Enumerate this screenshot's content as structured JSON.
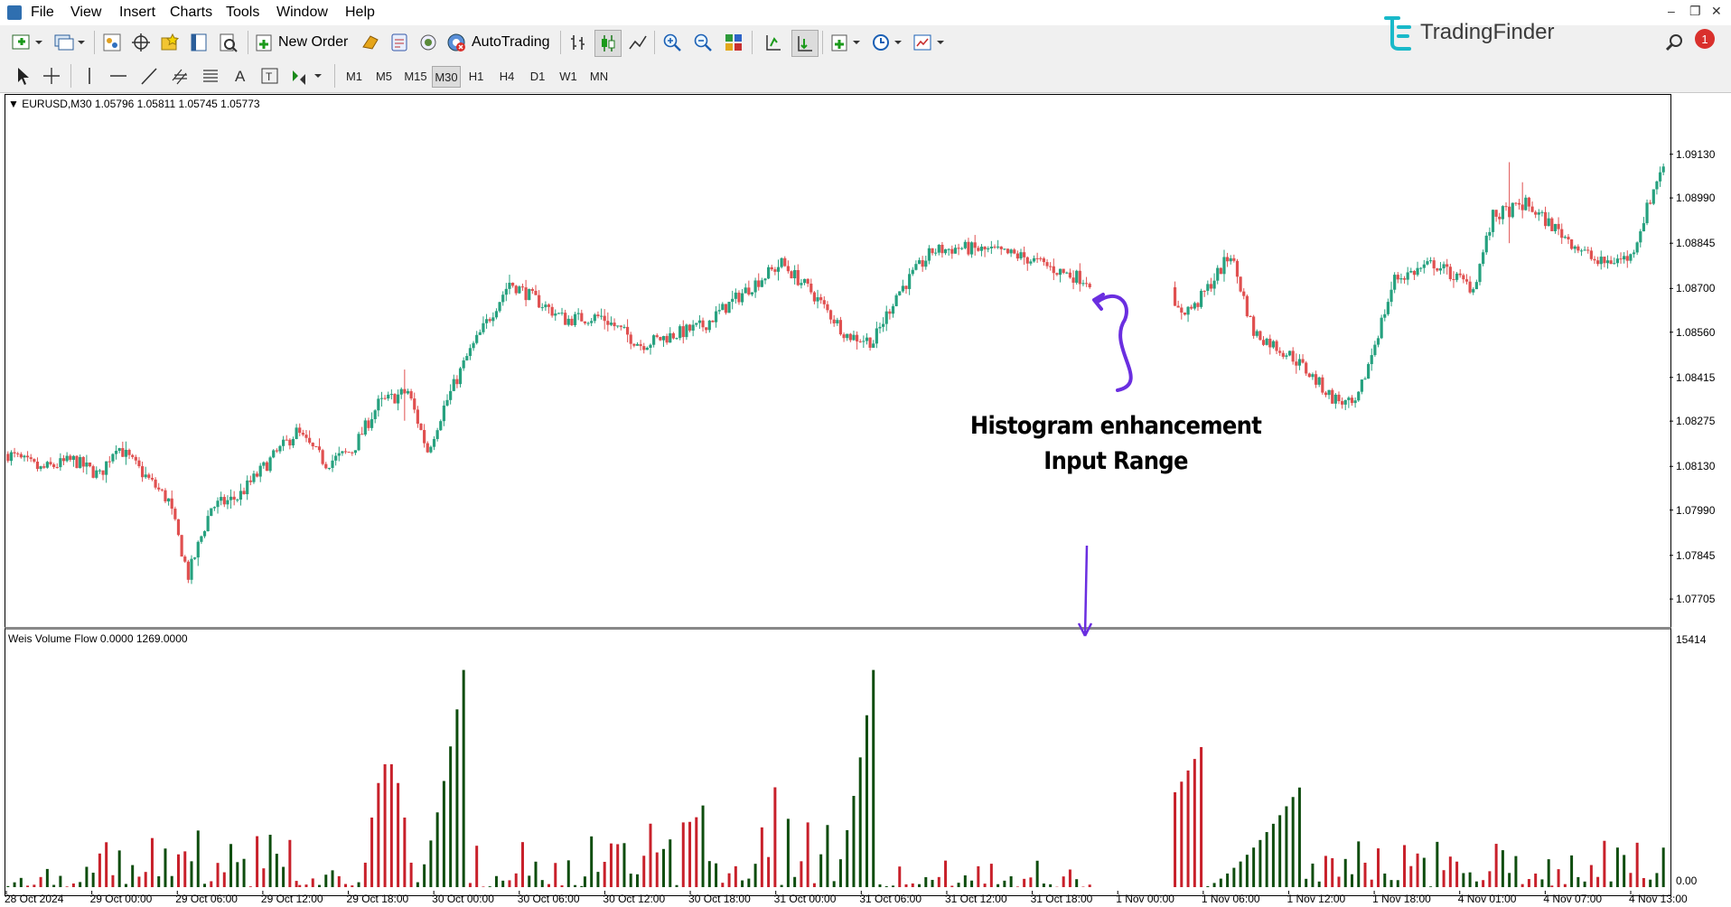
{
  "menu": {
    "items": [
      "File",
      "View",
      "Insert",
      "Charts",
      "Tools",
      "Window",
      "Help"
    ]
  },
  "toolbar": {
    "new_order_label": "New Order",
    "autotrading_label": "AutoTrading",
    "timeframes": [
      "M1",
      "M5",
      "M15",
      "M30",
      "H1",
      "H4",
      "D1",
      "W1",
      "MN"
    ],
    "active_timeframe": "M30"
  },
  "brand": {
    "name": "TradingFinder",
    "notification_count": "1",
    "accent": "#19b9c9"
  },
  "main_chart": {
    "header": "EURUSD,M30  1.05796 1.05811 1.05745 1.05773"
  },
  "sub_chart": {
    "header": "Weis Volume Flow 0.0000 1269.0000"
  },
  "annotation": {
    "line1": "Histogram enhancement",
    "line2": "Input Range",
    "arrow_color": "#6a2ee0"
  },
  "colors": {
    "bull": "#26a17f",
    "bear": "#e05050",
    "hist_bull": "#0e4d0e",
    "hist_bear": "#c8202a"
  },
  "chart_data": {
    "type": "candlestick",
    "symbol": "EURUSD",
    "timeframe": "M30",
    "ohlc_header": [
      "1.05796",
      "1.05811",
      "1.05745",
      "1.05773"
    ],
    "y_ticks": [
      "1.09130",
      "1.08990",
      "1.08845",
      "1.08700",
      "1.08560",
      "1.08415",
      "1.08275",
      "1.08130",
      "1.07990",
      "1.07845",
      "1.07705"
    ],
    "ylim": [
      1.0763,
      1.093
    ],
    "x_labels": [
      "28 Oct 2024",
      "29 Oct 00:00",
      "29 Oct 06:00",
      "29 Oct 12:00",
      "29 Oct 18:00",
      "30 Oct 00:00",
      "30 Oct 06:00",
      "30 Oct 12:00",
      "30 Oct 18:00",
      "31 Oct 00:00",
      "31 Oct 06:00",
      "31 Oct 12:00",
      "31 Oct 18:00",
      "1 Nov 00:00",
      "1 Nov 06:00",
      "1 Nov 12:00",
      "1 Nov 18:00",
      "4 Nov 01:00",
      "4 Nov 07:00",
      "4 Nov 13:00"
    ],
    "close_path": [
      [
        0,
        1.0817
      ],
      [
        10,
        1.0812
      ],
      [
        20,
        1.0815
      ],
      [
        28,
        1.081
      ],
      [
        33,
        1.082
      ],
      [
        40,
        1.0812
      ],
      [
        49,
        1.0802
      ],
      [
        55,
        1.0778
      ],
      [
        62,
        1.08
      ],
      [
        70,
        1.0803
      ],
      [
        80,
        1.0815
      ],
      [
        88,
        1.0824
      ],
      [
        97,
        1.0814
      ],
      [
        105,
        1.0818
      ],
      [
        113,
        1.0833
      ],
      [
        122,
        1.0837
      ],
      [
        128,
        1.0818
      ],
      [
        133,
        1.0832
      ],
      [
        140,
        1.0848
      ],
      [
        153,
        1.0872
      ],
      [
        170,
        1.086
      ],
      [
        181,
        1.0861
      ],
      [
        193,
        1.0852
      ],
      [
        212,
        1.0858
      ],
      [
        227,
        1.0871
      ],
      [
        236,
        1.0878
      ],
      [
        245,
        1.0869
      ],
      [
        256,
        1.0855
      ],
      [
        264,
        1.0853
      ],
      [
        271,
        1.0868
      ],
      [
        282,
        1.0882
      ],
      [
        290,
        1.0883
      ],
      [
        300,
        1.0882
      ],
      [
        310,
        1.088
      ],
      [
        322,
        1.0875
      ],
      [
        338,
        1.087
      ],
      [
        354,
        1.0862
      ],
      [
        362,
        1.0864
      ],
      [
        373,
        1.0881
      ],
      [
        380,
        1.0856
      ],
      [
        392,
        1.0848
      ],
      [
        404,
        1.0835
      ],
      [
        411,
        1.0832
      ],
      [
        423,
        1.0873
      ],
      [
        435,
        1.0878
      ],
      [
        447,
        1.087
      ],
      [
        453,
        1.0893
      ],
      [
        463,
        1.0897
      ],
      [
        485,
        1.0878
      ],
      [
        495,
        1.088
      ],
      [
        504,
        1.0908
      ]
    ],
    "volume_scale_label": "15414",
    "volume_bottom_label": "0.00",
    "volume_ylim": [
      0,
      15414
    ],
    "volume_waves": [
      {
        "from": 0,
        "to": 21,
        "peak": 1500,
        "dir": "mixed"
      },
      {
        "from": 22,
        "to": 55,
        "peak": 4200,
        "dir": "mixed"
      },
      {
        "from": 56,
        "to": 88,
        "peak": 4000,
        "dir": "mixed"
      },
      {
        "from": 89,
        "to": 108,
        "peak": 2000,
        "dir": "mixed"
      },
      {
        "from": 109,
        "to": 124,
        "peak": 7800,
        "dir": "up-then-down"
      },
      {
        "from": 125,
        "to": 140,
        "peak": 14800,
        "dir": "up"
      },
      {
        "from": 141,
        "to": 175,
        "peak": 3500,
        "dir": "mixed"
      },
      {
        "from": 176,
        "to": 251,
        "peak": 7000,
        "dir": "mixed"
      },
      {
        "from": 252,
        "to": 265,
        "peak": 15000,
        "dir": "up"
      },
      {
        "from": 266,
        "to": 327,
        "peak": 2000,
        "dir": "mixed"
      },
      {
        "from": 328,
        "to": 365,
        "peak": 9100,
        "dir": "down"
      },
      {
        "from": 366,
        "to": 395,
        "peak": 6500,
        "dir": "up"
      },
      {
        "from": 396,
        "to": 470,
        "peak": 3400,
        "dir": "mixed"
      },
      {
        "from": 471,
        "to": 505,
        "peak": 3000,
        "dir": "mixed"
      }
    ]
  }
}
